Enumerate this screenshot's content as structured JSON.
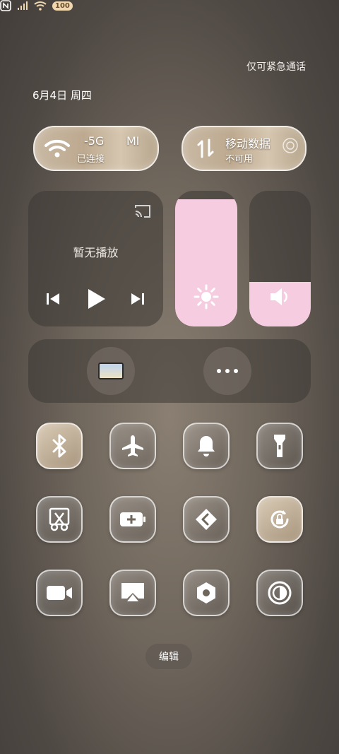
{
  "status_bar": {
    "emergency_text": "仅可紧急通话",
    "date_text": "6月4日 周四",
    "battery": "100"
  },
  "wifi_tile": {
    "title": "-5G",
    "extra": "MI",
    "subtitle": "已连接"
  },
  "data_tile": {
    "title": "移动数据",
    "subtitle": "不可用"
  },
  "media": {
    "empty_text": "暂无播放"
  },
  "sliders": {
    "brightness_level": 0.94,
    "volume_level": 0.33
  },
  "accent_colors": {
    "slider_fill": "#f6cde0",
    "battery_badge": "#f0d7b0"
  },
  "quick_tiles": [
    "bluetooth-icon",
    "airplane-icon",
    "bell-icon",
    "flashlight-icon",
    "screenshot-icon",
    "battery-saver-icon",
    "nearby-share-icon",
    "rotation-lock-icon",
    "video-camera-icon",
    "screen-cast-icon",
    "settings-icon",
    "dark-mode-icon"
  ],
  "edit_button": {
    "label": "编辑"
  }
}
